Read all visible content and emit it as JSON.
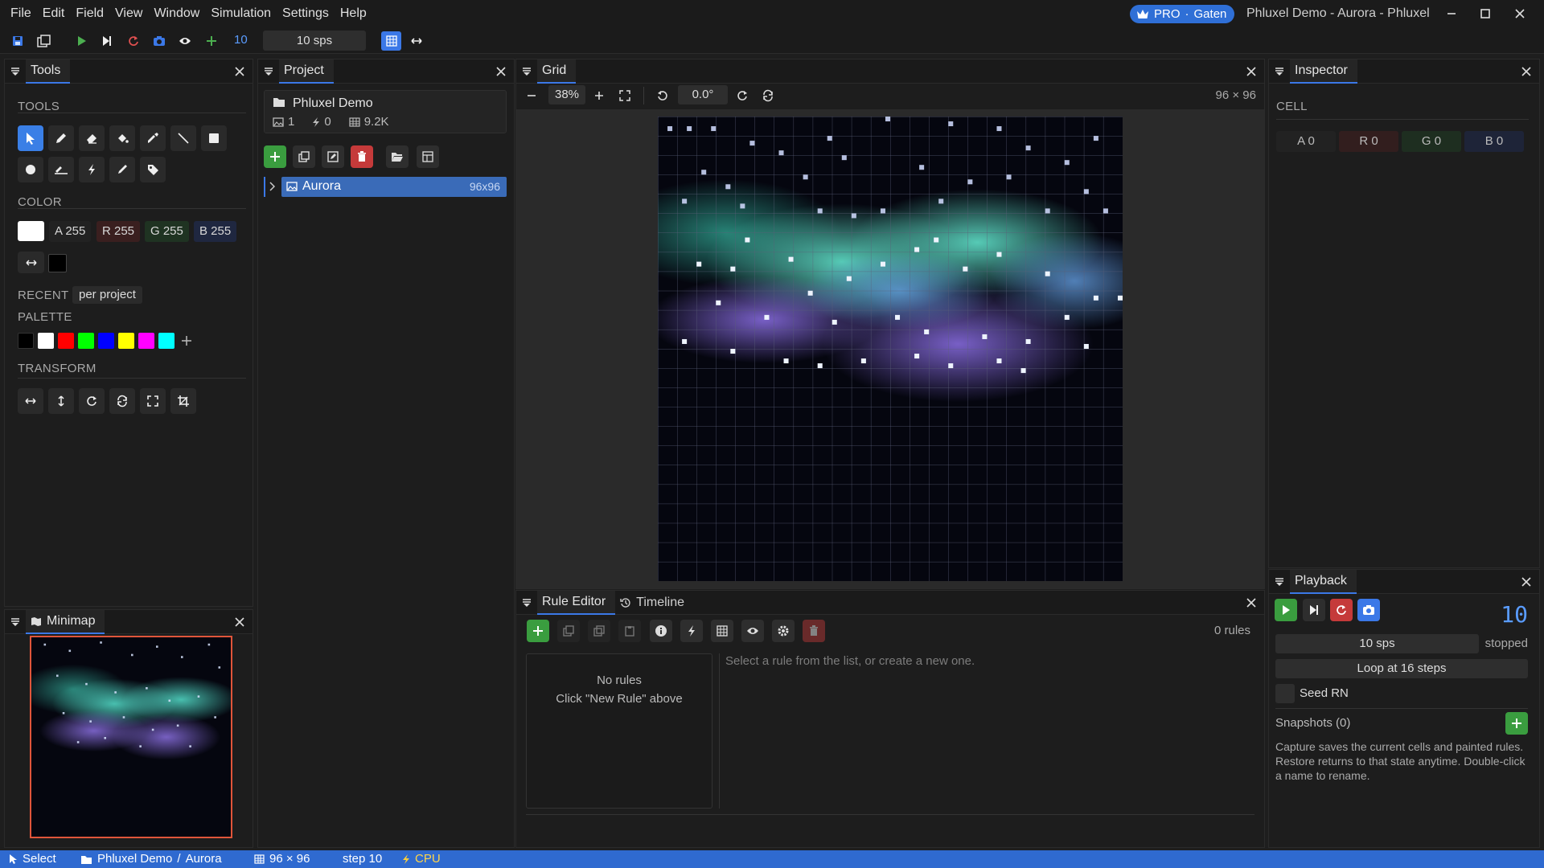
{
  "menu": [
    "File",
    "Edit",
    "Field",
    "View",
    "Window",
    "Simulation",
    "Settings",
    "Help"
  ],
  "pro_badge": {
    "tier": "PRO",
    "sep": "·",
    "user": "Gaten"
  },
  "window_title": "Phluxel Demo - Aurora - Phluxel",
  "toolbar": {
    "step_count": "10",
    "speed": "10 sps"
  },
  "tools_panel": {
    "title": "Tools",
    "tools_label": "TOOLS",
    "color_label": "COLOR",
    "channels": {
      "a": "A 255",
      "r": "R 255",
      "g": "G 255",
      "b": "B 255"
    },
    "recent_label": "RECENT",
    "recent_scope": "per project",
    "palette_label": "PALETTE",
    "palette": [
      "#000000",
      "#ffffff",
      "#ff0000",
      "#00ff00",
      "#0000ff",
      "#ffff00",
      "#ff00ff",
      "#00ffff"
    ],
    "transform_label": "TRANSFORM"
  },
  "minimap": {
    "title": "Minimap"
  },
  "project": {
    "title": "Project",
    "name": "Phluxel Demo",
    "stats": {
      "images": "1",
      "rules": "0",
      "cells": "9.2K"
    },
    "items": [
      {
        "name": "Aurora",
        "size": "96x96"
      }
    ]
  },
  "grid": {
    "title": "Grid",
    "zoom": "38%",
    "rotation": "0.0°",
    "dims": "96 × 96"
  },
  "rule_editor": {
    "tabs": [
      "Rule Editor",
      "Timeline"
    ],
    "count": "0 rules",
    "empty_title": "No rules",
    "empty_hint": "Click \"New Rule\" above",
    "detail_hint": "Select a rule from the list, or create a new one."
  },
  "inspector": {
    "title": "Inspector",
    "cell_label": "CELL",
    "channels": {
      "a": "A 0",
      "r": "R 0",
      "g": "G 0",
      "b": "B 0"
    }
  },
  "playback": {
    "title": "Playback",
    "step": "10",
    "speed": "10 sps",
    "state": "stopped",
    "loop": "Loop at 16 steps",
    "seed": "Seed RN",
    "snapshots": "Snapshots (0)",
    "help": "Capture saves the current cells and painted rules. Restore returns to that state anytime. Double-click a name to rename."
  },
  "status": {
    "tool": "Select",
    "project": "Phluxel Demo",
    "sep": "/",
    "image": "Aurora",
    "dims": "96 × 96",
    "step": "step 10",
    "backend": "CPU"
  },
  "colors": {
    "accent": "#3b78e7",
    "status_bar": "#2f6ad0",
    "green": "#3a9d3f",
    "red": "#c53a3a"
  }
}
